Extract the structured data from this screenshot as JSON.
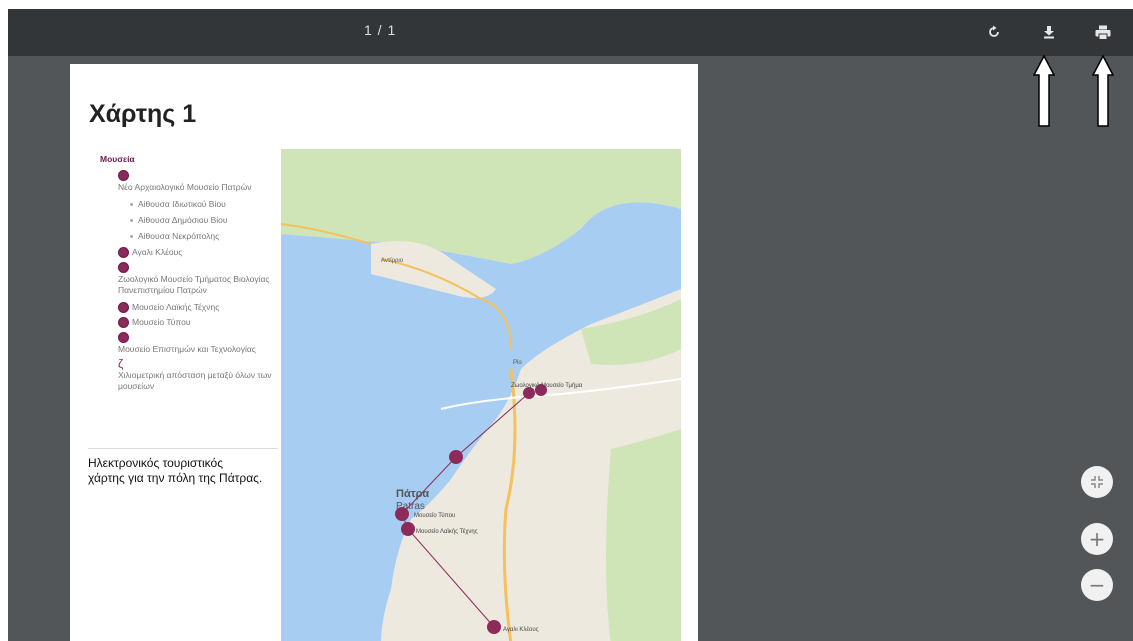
{
  "toolbar": {
    "page_counter": "1 / 1",
    "icons": [
      "rotate-icon",
      "download-icon",
      "print-icon"
    ]
  },
  "document": {
    "title": "Χάρτης 1",
    "legend": {
      "header": "Μουσεία",
      "items": [
        "Νέο Αρχαιολογικό Μουσείο Πατρών",
        "Αίθουσα Ιδιωτικού Βίου",
        "Αίθουσα Δημόσιου Βίου",
        "Αίθουσα Νεκρόπολης",
        "Αγαλι Κλέους",
        "Ζωολογικό Μουσείο Τμήματος Βιολογίας Πανεπιστημίου Πατρών",
        "Μουσείο Λαϊκής Τέχνης",
        "Μουσείο Τύπου",
        "Μουσείο Επιστημών και Τεχνολογίας",
        "Χιλιομετρική απόσταση μεταξύ όλων των μουσείων"
      ]
    },
    "description": "Ηλεκτρονικός τουριστικός χάρτης για την πόλη της Πάτρας."
  },
  "map": {
    "labels": [
      "Πάτρα",
      "Patras",
      "Μουσείο Τύπου",
      "Μουσείο Λαϊκής Τέχνης",
      "Αγαλι Κλέους",
      "Ζωολογικό Μουσείο Τμήμα",
      "Ρίο",
      "Αντίρριο"
    ],
    "colors": {
      "water": "#a7cdf2",
      "land": "#ede9df",
      "green": "#cfe5b8",
      "road": "#f3c15d",
      "pin": "#8c2a5a"
    }
  },
  "controls": {
    "fit_icon": "fit-page-icon",
    "zoom_in_label": "+",
    "zoom_out_label": "−"
  }
}
